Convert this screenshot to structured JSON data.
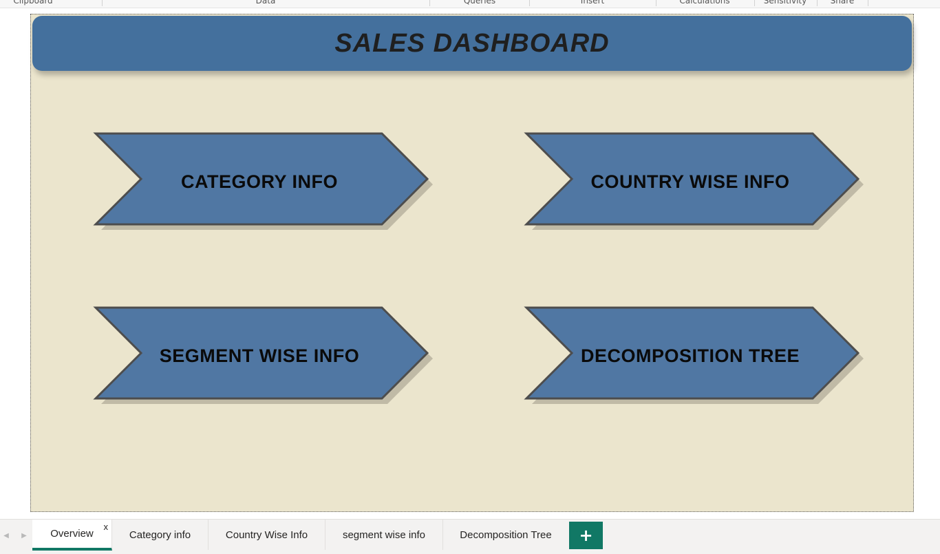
{
  "ribbon": {
    "groups": [
      "Clipboard",
      "Data",
      "Queries",
      "Insert",
      "Calculations",
      "Sensitivity",
      "Share"
    ]
  },
  "dashboard": {
    "title": "SALES DASHBOARD",
    "buttons": [
      {
        "label": "CATEGORY INFO"
      },
      {
        "label": "COUNTRY WISE INFO"
      },
      {
        "label": "SEGMENT WISE INFO"
      },
      {
        "label": "DECOMPOSITION TREE"
      }
    ]
  },
  "tabs": {
    "items": [
      {
        "label": "Overview",
        "active": true,
        "close": "x"
      },
      {
        "label": "Category info"
      },
      {
        "label": "Country Wise Info"
      },
      {
        "label": "segment wise info"
      },
      {
        "label": "Decomposition Tree"
      }
    ],
    "add_label": "+"
  },
  "colors": {
    "canvas": "#ebe5cd",
    "header": "#44709d",
    "chevron_fill": "#5077a3",
    "chevron_stroke": "#4d4d4d",
    "tab_accent": "#117865"
  }
}
